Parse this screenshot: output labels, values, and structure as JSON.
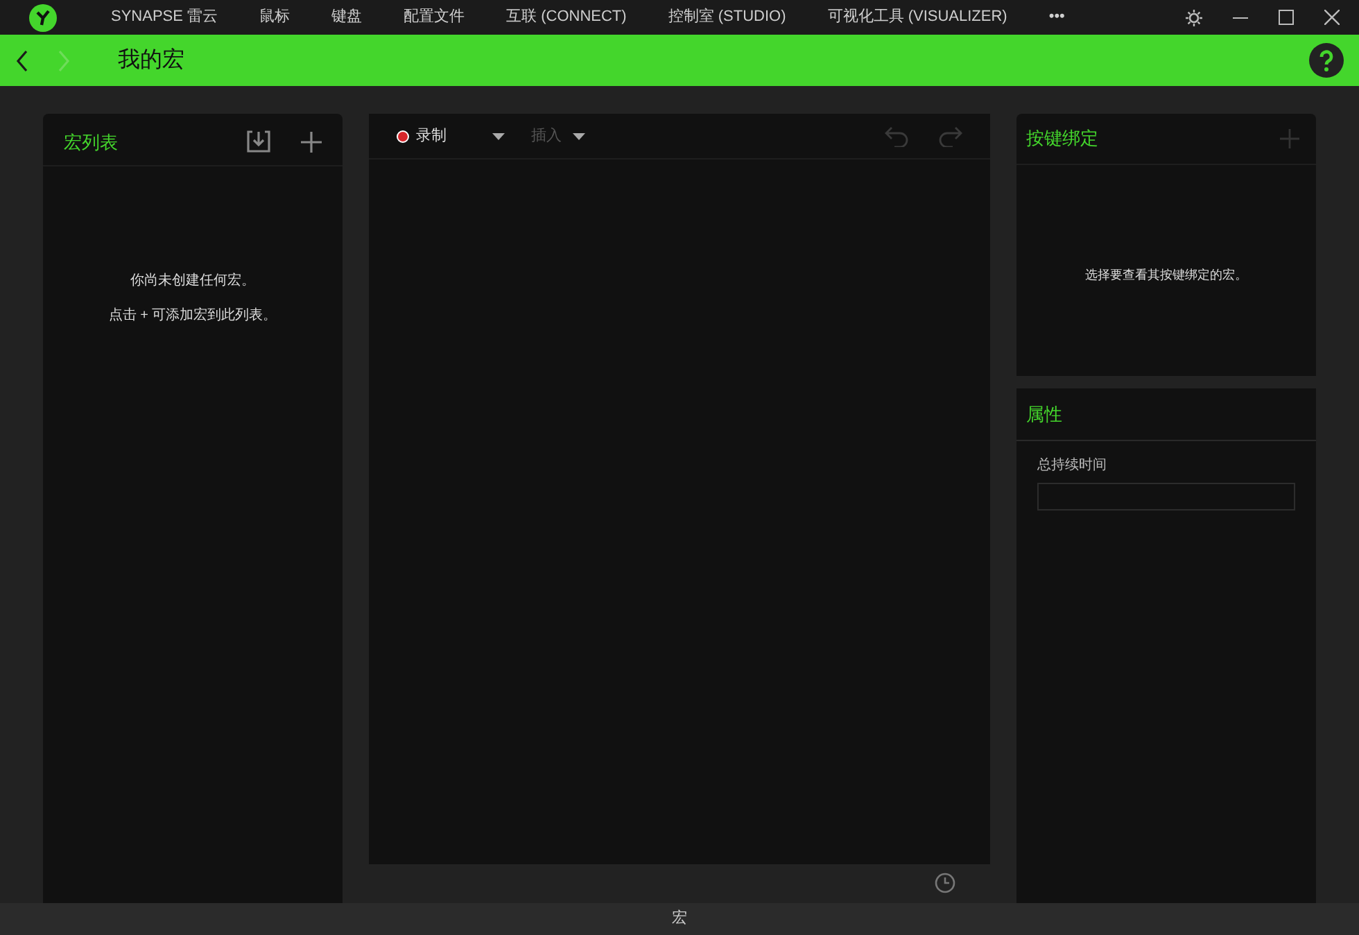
{
  "title_bar": {
    "nav_items": [
      "SYNAPSE 雷云",
      "鼠标",
      "键盘",
      "配置文件",
      "互联 (CONNECT)",
      "控制室 (STUDIO)",
      "可视化工具 (VISUALIZER)",
      "•••"
    ]
  },
  "header": {
    "title": "我的宏",
    "back": {
      "disabled": false
    },
    "forward": {
      "disabled": true
    }
  },
  "macro_list": {
    "title": "宏列表",
    "empty_messages": [
      "你尚未创建任何宏。",
      "点击 + 可添加宏到此列表。"
    ]
  },
  "editor": {
    "record": {
      "label": "录制",
      "disabled": false
    },
    "insert": {
      "label": "插入",
      "disabled": true
    },
    "undo": {
      "disabled": true
    },
    "redo": {
      "disabled": true
    }
  },
  "key_binding": {
    "title": "按键绑定",
    "message": "选择要查看其按键绑定的宏。",
    "add": {
      "disabled": true
    }
  },
  "properties": {
    "title": "属性",
    "field_label": "总持续时间"
  },
  "bottom_tab": {
    "label": "宏"
  }
}
